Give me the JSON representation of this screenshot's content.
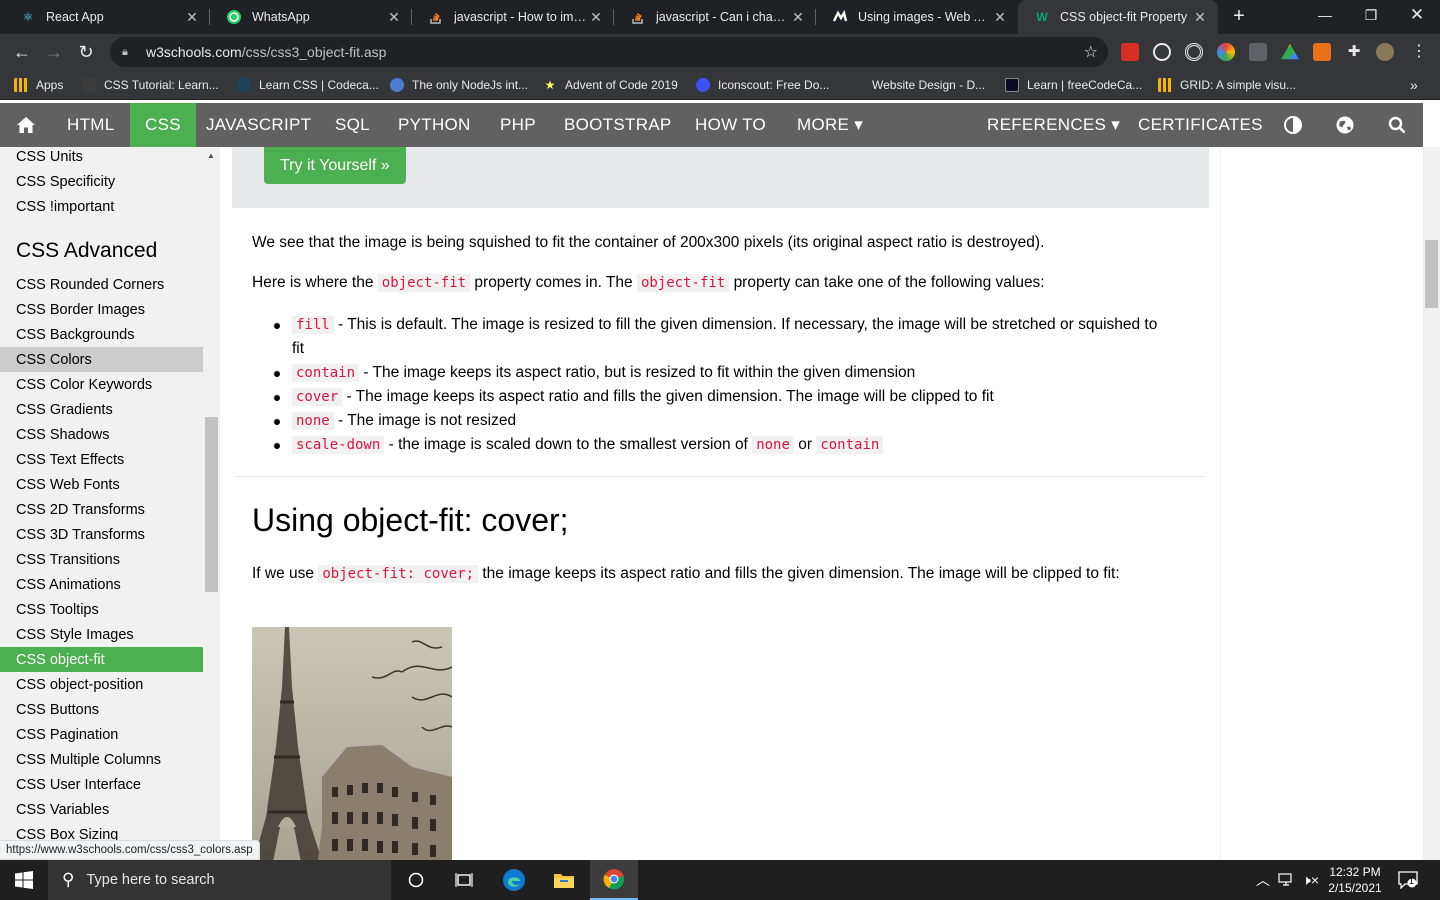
{
  "browser": {
    "tabs": [
      {
        "title": "React App",
        "icon": "react-icon",
        "active": false
      },
      {
        "title": "WhatsApp",
        "icon": "whatsapp-icon",
        "active": false
      },
      {
        "title": "javascript - How to impor",
        "icon": "stackoverflow-icon",
        "active": false
      },
      {
        "title": "javascript - Can i change t",
        "icon": "stackoverflow-icon",
        "active": false
      },
      {
        "title": "Using images - Web APIs",
        "icon": "mdn-icon",
        "active": false
      },
      {
        "title": "CSS object-fit Property",
        "icon": "w3schools-icon",
        "active": true
      }
    ],
    "url_domain": "w3schools.com",
    "url_path": "/css/css3_object-fit.asp",
    "bookmarks": [
      {
        "label": "Apps",
        "color": "#f4b400"
      },
      {
        "label": "CSS Tutorial: Learn...",
        "color": "#3b3b3b"
      },
      {
        "label": "Learn CSS | Codeca...",
        "color": "#1f4056"
      },
      {
        "label": "The only NodeJs int...",
        "color": "#4a7bd0"
      },
      {
        "label": "Advent of Code 2019",
        "color": "#0f0f23"
      },
      {
        "label": "Iconscout: Free Do...",
        "color": "#3f51f5"
      },
      {
        "label": "Website Design - D...",
        "color": "#35363a"
      },
      {
        "label": "Learn | freeCodeCa...",
        "color": "#0a0a23"
      },
      {
        "label": "GRID: A simple visu...",
        "color": "#f4b400"
      }
    ],
    "status_url": "https://www.w3schools.com/css/css3_colors.asp"
  },
  "w3nav": {
    "items": [
      "HTML",
      "CSS",
      "JAVASCRIPT",
      "SQL",
      "PYTHON",
      "PHP",
      "BOOTSTRAP",
      "HOW TO",
      "MORE ▾"
    ],
    "active": "CSS",
    "right_items": [
      "REFERENCES ▾",
      "CERTIFICATES"
    ]
  },
  "sidebar": {
    "top_items": [
      "CSS Units",
      "CSS Specificity",
      "CSS !important"
    ],
    "heading": "CSS Advanced",
    "items": [
      "CSS Rounded Corners",
      "CSS Border Images",
      "CSS Backgrounds",
      "CSS Colors",
      "CSS Color Keywords",
      "CSS Gradients",
      "CSS Shadows",
      "CSS Text Effects",
      "CSS Web Fonts",
      "CSS 2D Transforms",
      "CSS 3D Transforms",
      "CSS Transitions",
      "CSS Animations",
      "CSS Tooltips",
      "CSS Style Images",
      "CSS object-fit",
      "CSS object-position",
      "CSS Buttons",
      "CSS Pagination",
      "CSS Multiple Columns",
      "CSS User Interface",
      "CSS Variables",
      "CSS Box Sizing"
    ],
    "hovered": "CSS Colors",
    "active": "CSS object-fit"
  },
  "content": {
    "try_button": "Try it Yourself »",
    "p1": "We see that the image is being squished to fit the container of 200x300 pixels (its original aspect ratio is destroyed).",
    "p2_a": "Here is where the",
    "p2_code1": "object-fit",
    "p2_b": "property comes in. The",
    "p2_code2": "object-fit",
    "p2_c": "property can take one of the following values:",
    "values": [
      {
        "code": "fill",
        "text": "- This is default. The image is resized to fill the given dimension. If necessary, the image will be stretched or squished to fit"
      },
      {
        "code": "contain",
        "text": "- The image keeps its aspect ratio, but is resized to fit within the given dimension"
      },
      {
        "code": "cover",
        "text": "- The image keeps its aspect ratio and fills the given dimension. The image will be clipped to fit"
      },
      {
        "code": "none",
        "text": "- The image is not resized"
      }
    ],
    "last_value": {
      "code": "scale-down",
      "text": "- the image is scaled down to the smallest version of",
      "code2": "none",
      "or": "or",
      "code3": "contain"
    },
    "h2": "Using object-fit: cover;",
    "p3_a": "If we use",
    "p3_code": "object-fit: cover;",
    "p3_b": "the image keeps its aspect ratio and fills the given dimension. The image will be clipped to fit:"
  },
  "taskbar": {
    "search_placeholder": "Type here to search",
    "time": "12:32 PM",
    "date": "2/15/2021",
    "notifications": "1"
  }
}
